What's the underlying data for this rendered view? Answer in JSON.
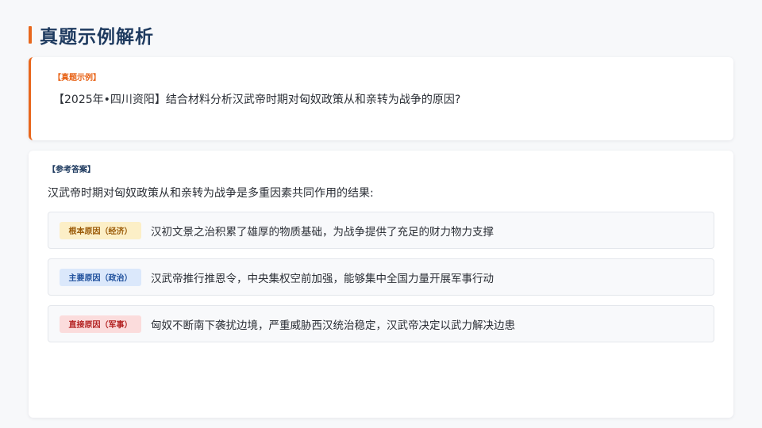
{
  "page": {
    "title": "真题示例解析"
  },
  "question": {
    "tag": "【真题示例】",
    "text": "【2025年•四川资阳】结合材料分析汉武帝时期对匈奴政策从和亲转为战争的原因?"
  },
  "answer": {
    "tag": "【参考答案】",
    "intro": "汉武帝时期对匈奴政策从和亲转为战争是多重因素共同作用的结果:",
    "reasons": [
      {
        "label": "根本原因（经济）",
        "text": "汉初文景之治积累了雄厚的物质基础，为战争提供了充足的财力物力支撑",
        "tag_bg": "#fcefc7",
        "tag_color": "#9a5a07"
      },
      {
        "label": "主要原因（政治）",
        "text": "汉武帝推行推恩令，中央集权空前加强，能够集中全国力量开展军事行动",
        "tag_bg": "#dbe8fb",
        "tag_color": "#1e4f9c"
      },
      {
        "label": "直接原因（军事）",
        "text": "匈奴不断南下袭扰边境，严重威胁西汉统治稳定，汉武帝决定以武力解决边患",
        "tag_bg": "#fbdcdc",
        "tag_color": "#b42323"
      }
    ]
  },
  "colors": {
    "accent": "#e8671d",
    "title": "#1e3a5f",
    "background": "#f7f8fa"
  }
}
